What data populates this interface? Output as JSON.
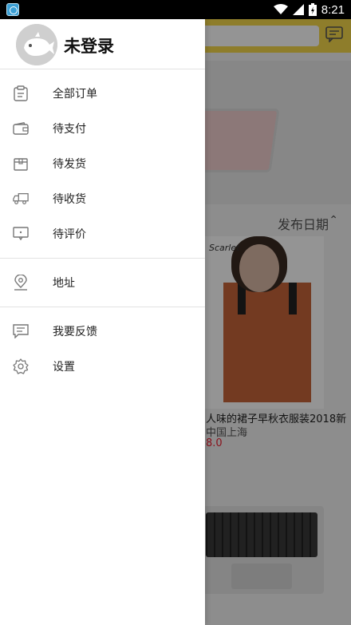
{
  "status_bar": {
    "time": "8:21",
    "battery_level": "charging"
  },
  "drawer": {
    "login_status": "未登录",
    "groups": [
      [
        {
          "label": "全部订单",
          "icon": "clipboard-icon"
        },
        {
          "label": "待支付",
          "icon": "wallet-icon"
        },
        {
          "label": "待发货",
          "icon": "package-icon"
        },
        {
          "label": "待收货",
          "icon": "truck-icon"
        },
        {
          "label": "待评价",
          "icon": "comment-icon"
        }
      ],
      [
        {
          "label": "地址",
          "icon": "location-pin-icon"
        }
      ],
      [
        {
          "label": "我要反馈",
          "icon": "feedback-icon"
        },
        {
          "label": "设置",
          "icon": "gear-icon"
        }
      ]
    ]
  },
  "background": {
    "sort_label": "发布日期",
    "product": {
      "brand": "Scarlet",
      "title": "人味的裙子早秋衣服装2018新",
      "location": "中国上海",
      "price": "8.0"
    }
  },
  "colors": {
    "accent": "#f5d84a",
    "price": "#e22233",
    "icon_gray": "#777777"
  }
}
